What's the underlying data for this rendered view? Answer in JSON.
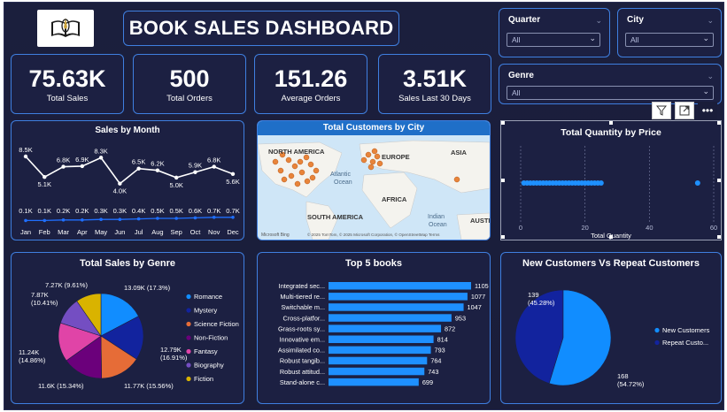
{
  "header": {
    "title": "BOOK SALES DASHBOARD",
    "logo_icon": "open-book-logo-icon"
  },
  "kpis": [
    {
      "value": "75.63K",
      "label": "Total Sales"
    },
    {
      "value": "500",
      "label": "Total Orders"
    },
    {
      "value": "151.26",
      "label": "Average Orders"
    },
    {
      "value": "3.51K",
      "label": "Sales Last 30 Days"
    }
  ],
  "slicers": {
    "quarter": {
      "label": "Quarter",
      "value": "All"
    },
    "city": {
      "label": "City",
      "value": "All"
    },
    "genre": {
      "label": "Genre",
      "value": "All"
    }
  },
  "visual_toolbar": {
    "icons": [
      "filter-icon",
      "focus-mode-icon",
      "more-options-icon"
    ]
  },
  "map": {
    "title": "Total Customers by City",
    "labels": [
      "NORTH AMERICA",
      "EUROPE",
      "ASIA",
      "Atlantic",
      "Ocean",
      "AFRICA",
      "SOUTH AMERICA",
      "Indian",
      "Ocean",
      "AUSTR"
    ],
    "attribution": "© 2025 TomTom, © 2025 Microsoft Corporation, © OpenStreetMap Terms",
    "brand": "Microsoft Bing"
  },
  "colors": {
    "accent": "#3f7fe0",
    "line": "#ffffff",
    "line2": "#1f6fff",
    "bar": "#1e90ff",
    "scatter": "#1e90ff",
    "genres": [
      "#118dff",
      "#12239e",
      "#e66c37",
      "#6b007b",
      "#e044a7",
      "#744ec2",
      "#d9b300"
    ],
    "customers": [
      "#118dff",
      "#12239e"
    ]
  },
  "chart_data": [
    {
      "id": "sales-by-month",
      "type": "line",
      "title": "Sales by Month",
      "categories": [
        "Jan",
        "Feb",
        "Mar",
        "Apr",
        "May",
        "Jun",
        "Jul",
        "Aug",
        "Sep",
        "Oct",
        "Nov",
        "Dec"
      ],
      "series": [
        {
          "values": [
            8.5,
            5.1,
            6.8,
            6.9,
            8.3,
            4.0,
            6.5,
            6.2,
            5.0,
            5.9,
            6.8,
            5.6
          ],
          "labels": [
            "8.5K",
            "5.1K",
            "6.8K",
            "6.9K",
            "8.3K",
            "4.0K",
            "6.5K",
            "6.2K",
            "5.0K",
            "5.9K",
            "6.8K",
            "5.6K"
          ]
        },
        {
          "values": [
            0.1,
            0.1,
            0.2,
            0.2,
            0.3,
            0.3,
            0.4,
            0.5,
            0.5,
            0.6,
            0.7,
            0.7
          ],
          "labels": [
            "0.1K",
            "0.1K",
            "0.2K",
            "0.2K",
            "0.3K",
            "0.3K",
            "0.4K",
            "0.5K",
            "0.5K",
            "0.6K",
            "0.7K",
            "0.7K"
          ]
        }
      ]
    },
    {
      "id": "total-quantity-by-price",
      "type": "scatter",
      "title": "Total Quantity by Price",
      "xlabel": "Total Quantity",
      "xticks": [
        "0",
        "20",
        "40",
        "60"
      ],
      "xlim": [
        0,
        60
      ],
      "points_x": [
        1,
        2,
        3,
        4,
        5,
        6,
        7,
        8,
        9,
        10,
        11,
        12,
        13,
        14,
        15,
        16,
        17,
        18,
        19,
        20,
        21,
        22,
        23,
        24,
        25,
        55
      ]
    },
    {
      "id": "total-sales-by-genre",
      "type": "pie",
      "title": "Total Sales by Genre",
      "categories": [
        "Romance",
        "Mystery",
        "Science Fiction",
        "Non-Fiction",
        "Fantasy",
        "Biography",
        "Fiction"
      ],
      "values": [
        13.09,
        12.79,
        11.77,
        11.6,
        11.24,
        7.87,
        7.27
      ],
      "labels": [
        "13.09K (17.3%)",
        "12.79K (16.91%)",
        "11.77K (15.56%)",
        "11.6K (15.34%)",
        "11.24K (14.86%)",
        "7.87K (10.41%)",
        "7.27K (9.61%)"
      ]
    },
    {
      "id": "top-5-books",
      "type": "bar",
      "title": "Top 5 books",
      "categories": [
        "Integrated sec...",
        "Multi-tiered re...",
        "Switchable m...",
        "Cross-platfor...",
        "Grass-roots sy...",
        "Innovative em...",
        "Assimilated co...",
        "Robust tangib...",
        "Robust attitud...",
        "Stand-alone c..."
      ],
      "values": [
        1105,
        1077,
        1047,
        953,
        872,
        814,
        793,
        764,
        743,
        699
      ],
      "xlim": [
        0,
        1105
      ]
    },
    {
      "id": "new-vs-repeat-customers",
      "type": "pie",
      "title": "New Customers Vs Repeat Customers",
      "categories": [
        "New Customers",
        "Repeat Custo..."
      ],
      "values": [
        168,
        139
      ],
      "labels": [
        "168 (54.72%)",
        "139 (45.28%)"
      ]
    }
  ]
}
